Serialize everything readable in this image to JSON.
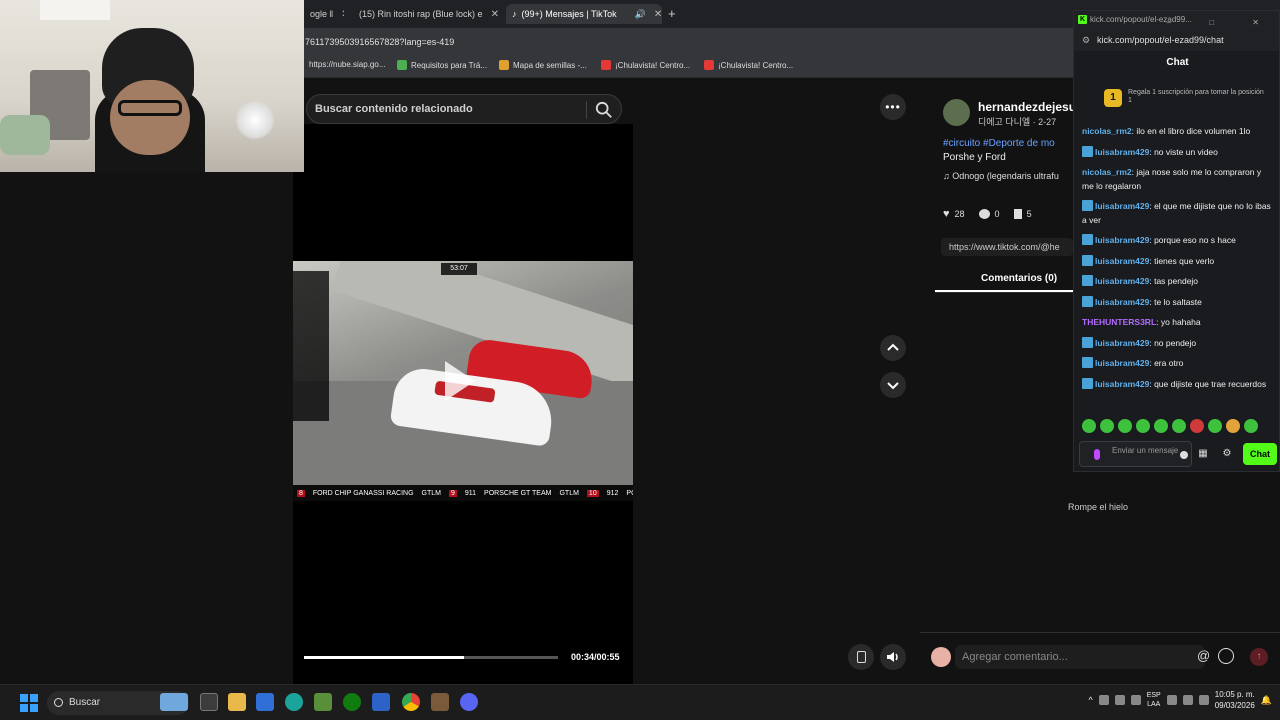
{
  "browser": {
    "tabs": [
      {
        "label": "ogle ‖",
        "active": false
      },
      {
        "label": "(15) Rin itoshi rap (Blue lock) e",
        "active": false
      },
      {
        "label": "(99+) Mensajes | TikTok",
        "active": true
      }
    ],
    "address": "7611739503916567828?lang=es-419",
    "bookmarks": [
      {
        "label": "https://nube.siap.go...",
        "color": "#9aa0a6"
      },
      {
        "label": "Requisitos para Trá...",
        "color": "#4caf50"
      },
      {
        "label": "Mapa de semillas -...",
        "color": "#e0a030"
      },
      {
        "label": "¡Chulavista! Centro...",
        "color": "#e53935"
      },
      {
        "label": "¡Chulavista! Centro...",
        "color": "#e53935"
      }
    ]
  },
  "tiktok": {
    "search_placeholder": "Buscar contenido relacionado",
    "video": {
      "timer": "53:07",
      "bottom_bar": [
        "8",
        "FORD CHIP GANASSI RACING",
        "GTLM",
        "9",
        "911",
        "PORSCHE GT TEAM",
        "GTLM",
        "10",
        "912",
        "PO"
      ],
      "progress_fraction": 0.63,
      "time": "00:34/00:55"
    },
    "author": {
      "name": "hernandezdejesus",
      "sub": "디에고 다니엘 · 2-27"
    },
    "tags": "#circuito #Deporte de mo",
    "description": "Porshe y Ford",
    "music": "♫  Odnogo (legendaris ultrafu",
    "stats": {
      "likes": "28",
      "comments": "0",
      "saves": "5"
    },
    "link": "https://www.tiktok.com/@he",
    "comments_tab": "Comentarios (0)",
    "icebreaker": "Rompe el hielo",
    "comment_placeholder": "Agregar comentario...",
    "at_symbol": "@"
  },
  "kick": {
    "window_title": "kick.com/popout/el-ezad99...",
    "window_buttons": "– □ ✕",
    "url": "kick.com/popout/el-ezad99/chat",
    "title": "Chat",
    "sub_banner": {
      "badge": "1",
      "text": "Regala 1 suscripción para tomar la posición 1"
    },
    "messages": [
      {
        "user": "nicolas_rm2",
        "color": "blue",
        "badge": false,
        "text": "ilo en el libro dice volumen 1lo"
      },
      {
        "user": "luisabram429",
        "color": "blue",
        "badge": true,
        "text": "no viste un video"
      },
      {
        "user": "nicolas_rm2",
        "color": "blue",
        "badge": false,
        "text": "jaja nose solo me lo compraron y me lo regalaron"
      },
      {
        "user": "luisabram429",
        "color": "blue",
        "badge": true,
        "text": "el que me dijiste que no lo ibas a ver"
      },
      {
        "user": "luisabram429",
        "color": "blue",
        "badge": true,
        "text": "porque eso no s hace"
      },
      {
        "user": "luisabram429",
        "color": "blue",
        "badge": true,
        "text": "tienes que verlo"
      },
      {
        "user": "luisabram429",
        "color": "blue",
        "badge": true,
        "text": "tas pendejo"
      },
      {
        "user": "luisabram429",
        "color": "blue",
        "badge": true,
        "text": "te lo saltaste"
      },
      {
        "user": "THEHUNTERS3RL",
        "color": "purple",
        "badge": false,
        "text": "yo hahaha"
      },
      {
        "user": "luisabram429",
        "color": "blue",
        "badge": true,
        "text": "no pendejo"
      },
      {
        "user": "luisabram429",
        "color": "blue",
        "badge": true,
        "text": "era otro"
      },
      {
        "user": "luisabram429",
        "color": "blue",
        "badge": true,
        "text": "que dijiste que trae recuerdos"
      }
    ],
    "input_placeholder": "Enviar un mensaje",
    "chat_button": "Chat"
  },
  "taskbar": {
    "search": "Buscar",
    "lang": [
      "ESP",
      "LAA"
    ],
    "time": "10:05 p. m.",
    "date": "09/03/2026"
  },
  "colors": {
    "kick_green": "#53fc18",
    "tiktok_link": "#6aa0ff",
    "chat_blue": "#5fb0ec",
    "chat_purple": "#b46cff"
  }
}
